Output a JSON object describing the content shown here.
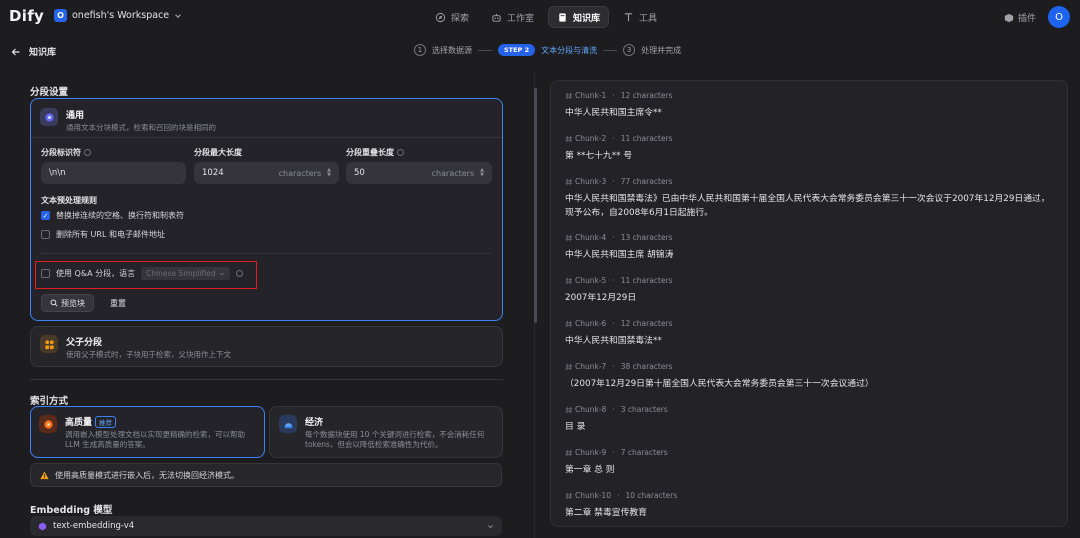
{
  "header": {
    "logo": "Dify",
    "workspace_initial": "O",
    "workspace_name": "onefish's Workspace",
    "nav": [
      {
        "label": "探索",
        "icon": "compass-icon"
      },
      {
        "label": "工作室",
        "icon": "robot-icon"
      },
      {
        "label": "知识库",
        "icon": "book-icon"
      },
      {
        "label": "工具",
        "icon": "tool-icon"
      }
    ],
    "plugins_label": "插件",
    "user_initial": "O"
  },
  "subheader": {
    "back_label": "知识库",
    "steps": [
      {
        "num": "1",
        "label": "选择数据源"
      },
      {
        "badge": "STEP 2",
        "label": "文本分段与清洗"
      },
      {
        "num": "3",
        "label": "处理并完成"
      }
    ]
  },
  "segment": {
    "section_title": "分段设置",
    "general": {
      "title": "通用",
      "desc": "通用文本分块模式，检索和召回的块是相同的",
      "delimiter_label": "分段标识符",
      "delimiter_value": "\\n\\n",
      "max_len_label": "分段最大长度",
      "max_len_value": "1024",
      "max_len_unit": "characters",
      "overlap_label": "分段重叠长度",
      "overlap_value": "50",
      "overlap_unit": "characters",
      "rules_title": "文本预处理规则",
      "rule_1": "替换掉连续的空格、换行符和制表符",
      "rule_2": "删除所有 URL 和电子邮件地址",
      "qa_label": "使用 Q&A 分段，语言",
      "qa_language": "Chinese Simplified",
      "preview_button": "预览块",
      "reset_button": "重置"
    },
    "parent_child": {
      "title": "父子分段",
      "desc": "使用父子模式时，子块用于检索，父块用作上下文"
    }
  },
  "index": {
    "section_title": "索引方式",
    "high_quality": {
      "title": "高质量",
      "badge": "推荐",
      "desc_1": "调用嵌入模型处理文档以实现更精确的检索，可以帮助",
      "desc_2": "LLM 生成高质量的答案。"
    },
    "economy": {
      "title": "经济",
      "desc_1": "每个数据块使用 10 个关键词进行检索，不会消耗任何",
      "desc_2": "tokens，但会以降低检索准确性为代价。"
    },
    "warning": "使用高质量模式进行嵌入后，无法切换回经济模式。"
  },
  "embedding": {
    "section_title": "Embedding 模型",
    "model": "text-embedding-v4"
  },
  "chunks": [
    {
      "label": "Chunk-1",
      "chars": "12 characters",
      "text": "中华人民共和国主席令**"
    },
    {
      "label": "Chunk-2",
      "chars": "11 characters",
      "text": "第 **七十九** 号"
    },
    {
      "label": "Chunk-3",
      "chars": "77 characters",
      "text": "中华人民共和国禁毒法》已由中华人民共和国第十届全国人民代表大会常务委员会第三十一次会议于2007年12月29日通过，现予公布，自2008年6月1日起施行。"
    },
    {
      "label": "Chunk-4",
      "chars": "13 characters",
      "text": "中华人民共和国主席 胡锦涛"
    },
    {
      "label": "Chunk-5",
      "chars": "11 characters",
      "text": "2007年12月29日"
    },
    {
      "label": "Chunk-6",
      "chars": "12 characters",
      "text": "中华人民共和国禁毒法**"
    },
    {
      "label": "Chunk-7",
      "chars": "38 characters",
      "text": "（2007年12月29日第十届全国人民代表大会常务委员会第三十一次会议通过）"
    },
    {
      "label": "Chunk-8",
      "chars": "3 characters",
      "text": "目 录"
    },
    {
      "label": "Chunk-9",
      "chars": "7 characters",
      "text": "第一章 总 则"
    },
    {
      "label": "Chunk-10",
      "chars": "10 characters",
      "text": "第二章 禁毒宣传教育"
    }
  ],
  "chunk_separator": "·",
  "colors": {
    "accent": "#2563eb",
    "highlight_box": "#e11d1d",
    "background": "#1d1d20"
  }
}
